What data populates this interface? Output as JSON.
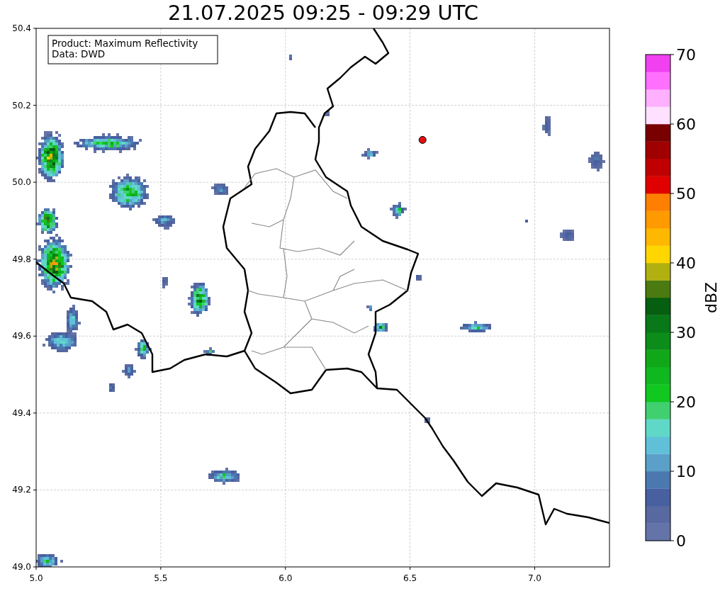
{
  "title": "21.07.2025 09:25 - 09:29 UTC",
  "info_box": {
    "lines": [
      "Product: Maximum Reflectivity",
      "Data: DWD"
    ]
  },
  "map": {
    "x_ticks": [
      "5.0",
      "5.5",
      "6.0",
      "6.5",
      "7.0"
    ],
    "y_ticks": [
      "50.4",
      "50.2",
      "50.0",
      "49.8",
      "49.6",
      "49.4",
      "49.2",
      "49.0"
    ]
  },
  "colorbar": {
    "label": "dBZ",
    "ticks": [
      "70",
      "60",
      "50",
      "40",
      "30",
      "20",
      "10",
      "0"
    ],
    "bins": [
      {
        "color": "#6474a8"
      },
      {
        "color": "#5868a0"
      },
      {
        "color": "#4860a0"
      },
      {
        "color": "#4c78b0"
      },
      {
        "color": "#5aa0c8"
      },
      {
        "color": "#60c0d8"
      },
      {
        "color": "#60d8c8"
      },
      {
        "color": "#40d070"
      },
      {
        "color": "#10c820"
      },
      {
        "color": "#10b820"
      },
      {
        "color": "#10a818"
      },
      {
        "color": "#0c8c18"
      },
      {
        "color": "#087818"
      },
      {
        "color": "#065e10"
      },
      {
        "color": "#4a7a10"
      },
      {
        "color": "#b0b010"
      },
      {
        "color": "#ffd600"
      },
      {
        "color": "#ffb800"
      },
      {
        "color": "#ff9a00"
      },
      {
        "color": "#ff7f00"
      },
      {
        "color": "#e00000"
      },
      {
        "color": "#c00000"
      },
      {
        "color": "#a00000"
      },
      {
        "color": "#780000"
      },
      {
        "color": "#ffe0ff"
      },
      {
        "color": "#ffb0ff"
      },
      {
        "color": "#ff70ff"
      },
      {
        "color": "#f040f0"
      }
    ]
  }
}
